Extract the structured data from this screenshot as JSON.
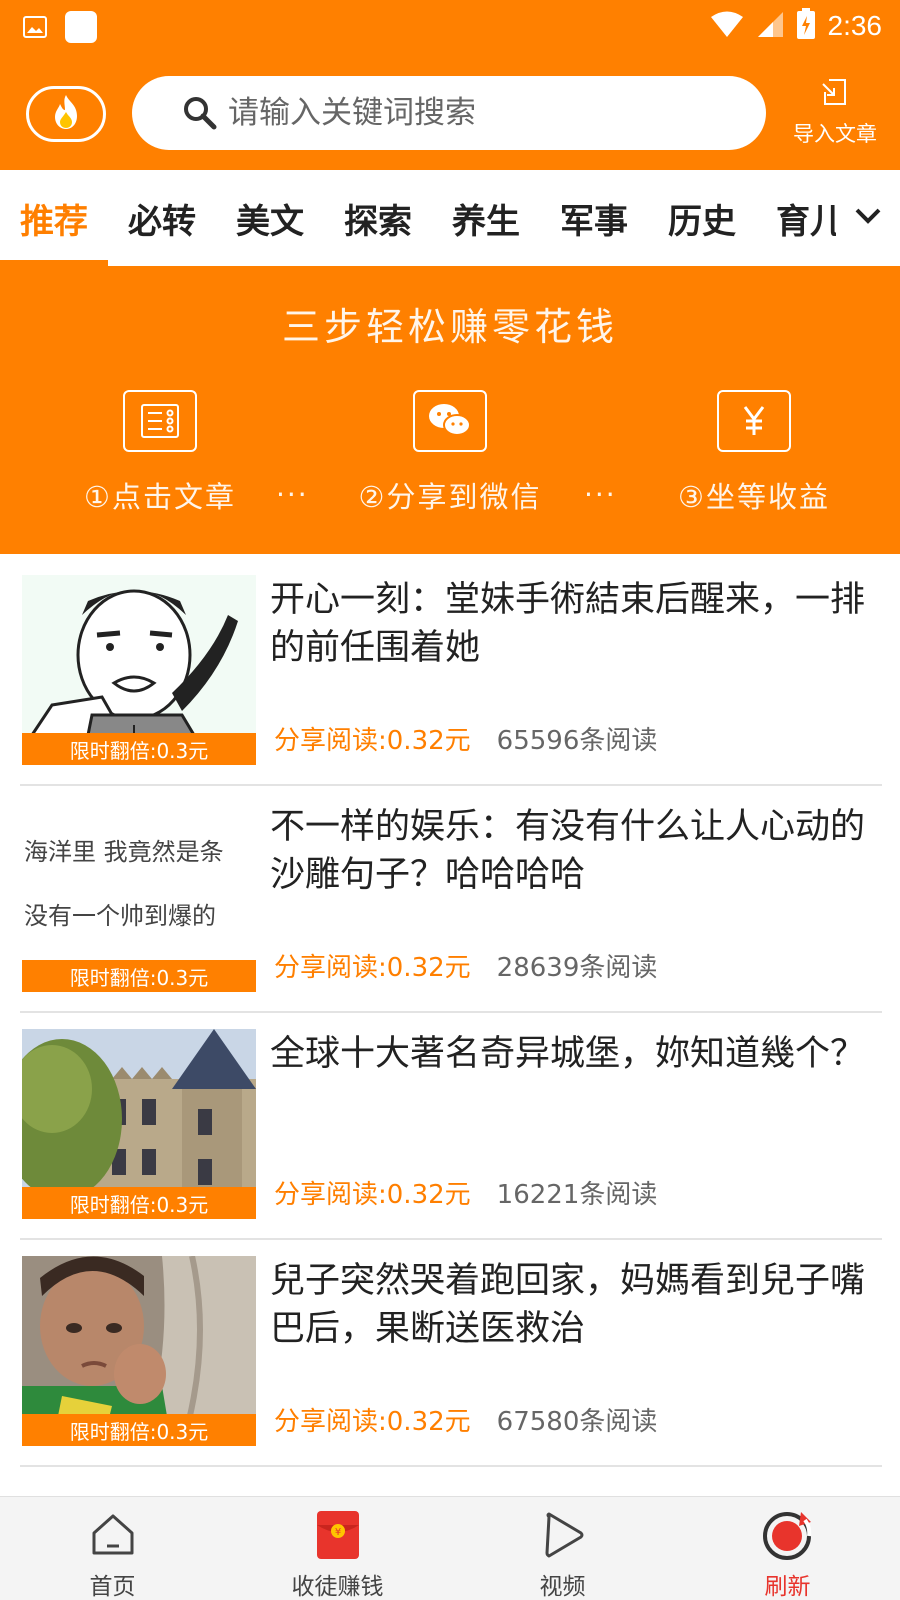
{
  "status_bar": {
    "time": "2:36",
    "icons": [
      "gallery-icon",
      "app-icon",
      "wifi-icon",
      "signal-icon",
      "battery-charging-icon"
    ]
  },
  "header": {
    "logo_icon": "flame-icon",
    "search_placeholder": "请输入关键词搜索",
    "import_label": "导入文章"
  },
  "tabs": {
    "items": [
      {
        "label": "推荐",
        "active": true
      },
      {
        "label": "必转",
        "active": false
      },
      {
        "label": "美文",
        "active": false
      },
      {
        "label": "探索",
        "active": false
      },
      {
        "label": "养生",
        "active": false
      },
      {
        "label": "军事",
        "active": false
      },
      {
        "label": "历史",
        "active": false
      },
      {
        "label": "育儿",
        "active": false
      }
    ],
    "more_icon": "chevron-down-icon"
  },
  "banner": {
    "title": "三步轻松赚零花钱",
    "steps": [
      {
        "label": "①点击文章",
        "icon": "article-icon"
      },
      {
        "label": "②分享到微信",
        "icon": "wechat-icon"
      },
      {
        "label": "③坐等收益",
        "icon": "yuan-icon"
      }
    ],
    "separator": "···"
  },
  "articles": [
    {
      "title": "开心一刻：堂妹手術結束后醒来，一排的前任围着她",
      "badge": "限时翻倍:0.3元",
      "share": "分享阅读:0.32元",
      "reads": "65596条阅读",
      "thumb": "meme-face-image"
    },
    {
      "title": "不一样的娱乐：有没有什么让人心动的沙雕句子？哈哈哈哈",
      "badge": "限时翻倍:0.3元",
      "share": "分享阅读:0.32元",
      "reads": "28639条阅读",
      "thumb": "handwriting-image",
      "thumb_text": [
        "海洋里 我竟然是条",
        "没有一个帅到爆的"
      ]
    },
    {
      "title": "全球十大著名奇异城堡，妳知道幾个？",
      "badge": "限时翻倍:0.3元",
      "share": "分享阅读:0.32元",
      "reads": "16221条阅读",
      "thumb": "castle-image"
    },
    {
      "title": "兒子突然哭着跑回家，妈媽看到兒子嘴巴后，果断送医救治",
      "badge": "限时翻倍:0.3元",
      "share": "分享阅读:0.32元",
      "reads": "67580条阅读",
      "thumb": "crying-child-image"
    }
  ],
  "bottom_nav": {
    "items": [
      {
        "label": "首页",
        "icon": "home-icon"
      },
      {
        "label": "收徒赚钱",
        "icon": "red-envelope-icon"
      },
      {
        "label": "视频",
        "icon": "play-icon"
      },
      {
        "label": "刷新",
        "icon": "refresh-icon"
      }
    ]
  },
  "colors": {
    "brand_orange": "#ff8000",
    "active_tab": "#ff7f00",
    "refresh_red": "#e8342c"
  }
}
